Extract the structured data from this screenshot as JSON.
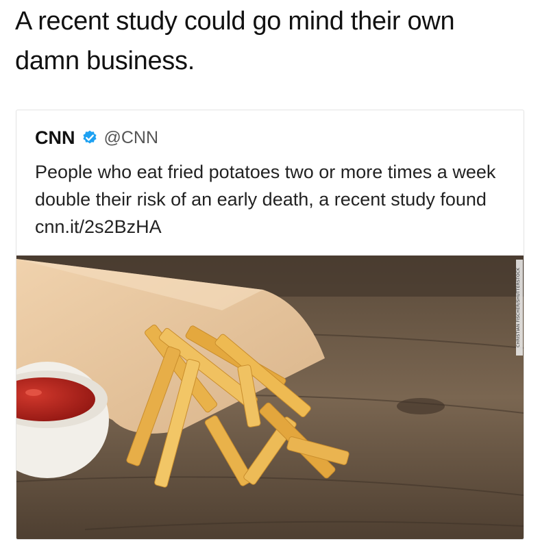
{
  "post": {
    "caption": "A recent study could go mind their own damn business."
  },
  "tweet": {
    "author_name": "CNN",
    "verified_icon": "verified-badge-icon",
    "handle": "@CNN",
    "text": "People who eat fried potatoes two or more times a week double their risk of an early death, a recent study found cnn.it/2s2BzHA",
    "image": {
      "subject": "french-fries-in-paper-cone-with-ketchup",
      "credit": "CHRISTIAN FISCHER/SHUTTERSTOCK"
    }
  },
  "colors": {
    "verified_blue": "#1da1f2",
    "wood": "#6b5844",
    "fries": "#e9b24a",
    "paper": "#ecc9a0",
    "ketchup": "#b3201a"
  }
}
